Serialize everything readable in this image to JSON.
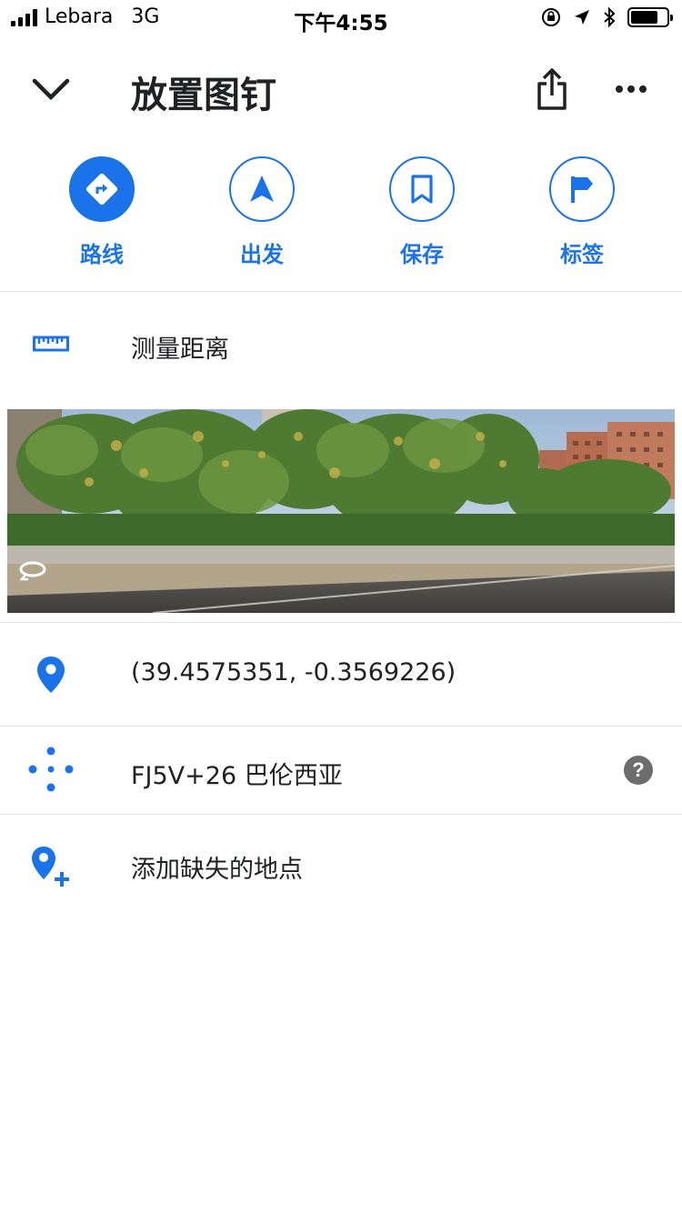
{
  "status_bar": {
    "carrier": "Lebara",
    "network": "3G",
    "time": "下午4:55",
    "battery_level": 0.75
  },
  "header": {
    "title": "放置图钉"
  },
  "actions": [
    {
      "label": "路线",
      "icon": "directions-icon"
    },
    {
      "label": "出发",
      "icon": "navigation-arrow-icon"
    },
    {
      "label": "保存",
      "icon": "bookmark-icon"
    },
    {
      "label": "标签",
      "icon": "flag-icon"
    }
  ],
  "measure": {
    "label": "测量距离",
    "icon": "ruler-icon"
  },
  "coordinates": {
    "text": "(39.4575351, -0.3569226)",
    "icon": "map-pin-icon"
  },
  "plus_code": {
    "text": "FJ5V+26 巴伦西亚",
    "icon": "plus-code-icon",
    "help": "?"
  },
  "add_place": {
    "label": "添加缺失的地点",
    "icon": "add-place-icon"
  },
  "colors": {
    "accent": "#1a73e8",
    "text": "#202124",
    "divider": "#e3e3e3"
  }
}
